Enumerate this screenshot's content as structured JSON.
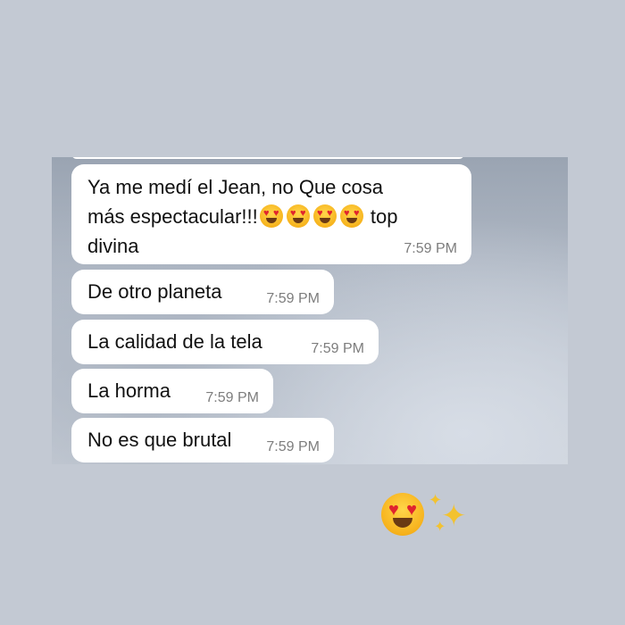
{
  "chat": {
    "messages": [
      {
        "line1": "Ya me medí el Jean, no Que cosa",
        "line2_prefix": "más espectacular!!!",
        "line2_suffix": " top",
        "line3": "divina",
        "time": "7:59 PM",
        "emojis": [
          "heart-eyes-emoji",
          "heart-eyes-emoji",
          "heart-eyes-emoji",
          "heart-eyes-emoji"
        ]
      },
      {
        "text": "De otro planeta",
        "time": "7:59 PM"
      },
      {
        "text": "La calidad de la tela",
        "time": "7:59 PM"
      },
      {
        "text": "La horma",
        "time": "7:59 PM"
      },
      {
        "text": "No es que brutal",
        "time": "7:59 PM"
      }
    ]
  },
  "overlay": {
    "emojis": [
      "heart-eyes-emoji",
      "sparkles-emoji"
    ]
  },
  "colors": {
    "page_background": "#c3c9d3",
    "bubble": "#ffffff",
    "timestamp": "#7d7d7d"
  }
}
